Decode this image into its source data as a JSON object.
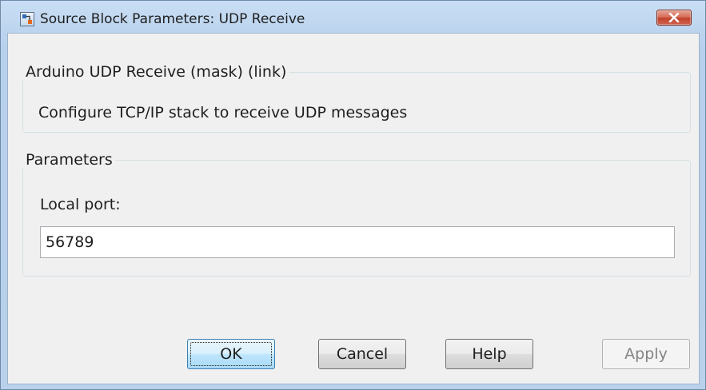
{
  "window": {
    "title": "Source Block Parameters: UDP Receive",
    "app_icon": "simulink-block-icon",
    "close_icon": "close-icon"
  },
  "mask_group": {
    "legend": "Arduino UDP Receive (mask) (link)",
    "description": "Configure TCP/IP stack to receive UDP messages"
  },
  "parameters_group": {
    "legend": "Parameters",
    "local_port_label": "Local port:",
    "local_port_value": "56789"
  },
  "buttons": {
    "ok": "OK",
    "cancel": "Cancel",
    "help": "Help",
    "apply": "Apply"
  },
  "colors": {
    "title_bar": "#bcd4ee",
    "close_button": "#c9503c",
    "client_bg": "#f0f0f0",
    "default_button_border": "#3c7fb1"
  }
}
